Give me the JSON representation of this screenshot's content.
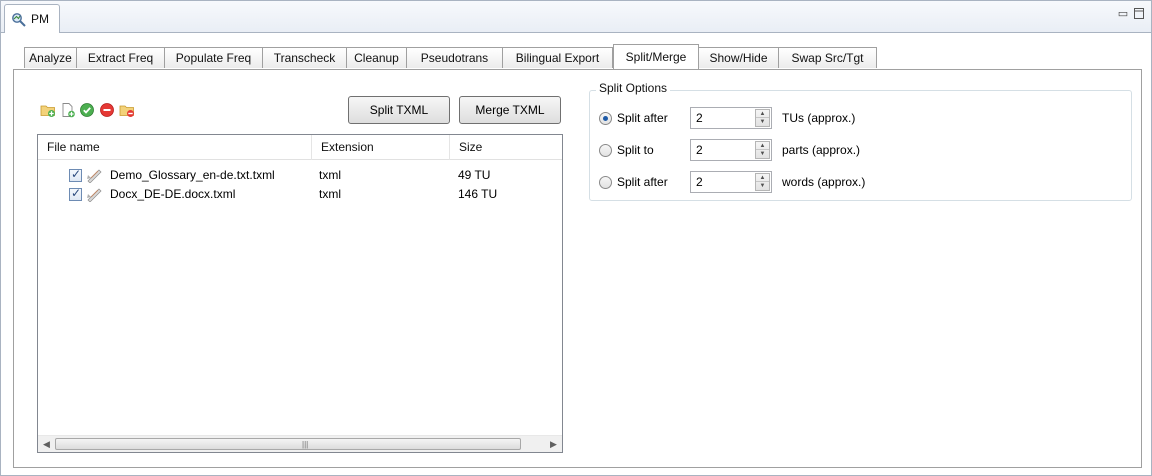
{
  "window": {
    "title": "PM"
  },
  "tabs": [
    {
      "label": "Analyze"
    },
    {
      "label": "Extract Freq"
    },
    {
      "label": "Populate Freq"
    },
    {
      "label": "Transcheck"
    },
    {
      "label": "Cleanup"
    },
    {
      "label": "Pseudotrans"
    },
    {
      "label": "Bilingual Export"
    },
    {
      "label": "Split/Merge",
      "active": true
    },
    {
      "label": "Show/Hide"
    },
    {
      "label": "Swap Src/Tgt"
    }
  ],
  "toolbar": {
    "icons": [
      "add-folder-icon",
      "add-file-icon",
      "check-all-icon",
      "remove-icon",
      "remove-folder-icon"
    ],
    "split_label": "Split TXML",
    "merge_label": "Merge TXML"
  },
  "table": {
    "columns": [
      "File name",
      "Extension",
      "Size"
    ],
    "rows": [
      {
        "checked": true,
        "name": "Demo_Glossary_en-de.txt.txml",
        "ext": "txml",
        "size": "49 TU"
      },
      {
        "checked": true,
        "name": "Docx_DE-DE.docx.txml",
        "ext": "txml",
        "size": "146 TU"
      }
    ]
  },
  "split_options": {
    "title": "Split Options",
    "options": [
      {
        "label": "Split after",
        "value": "2",
        "unit": "TUs (approx.)",
        "selected": true
      },
      {
        "label": "Split to",
        "value": "2",
        "unit": "parts (approx.)",
        "selected": false
      },
      {
        "label": "Split after",
        "value": "2",
        "unit": "words (approx.)",
        "selected": false
      }
    ]
  },
  "colors": {
    "accent": "#1d5aa7",
    "border": "#a0a0a0"
  }
}
